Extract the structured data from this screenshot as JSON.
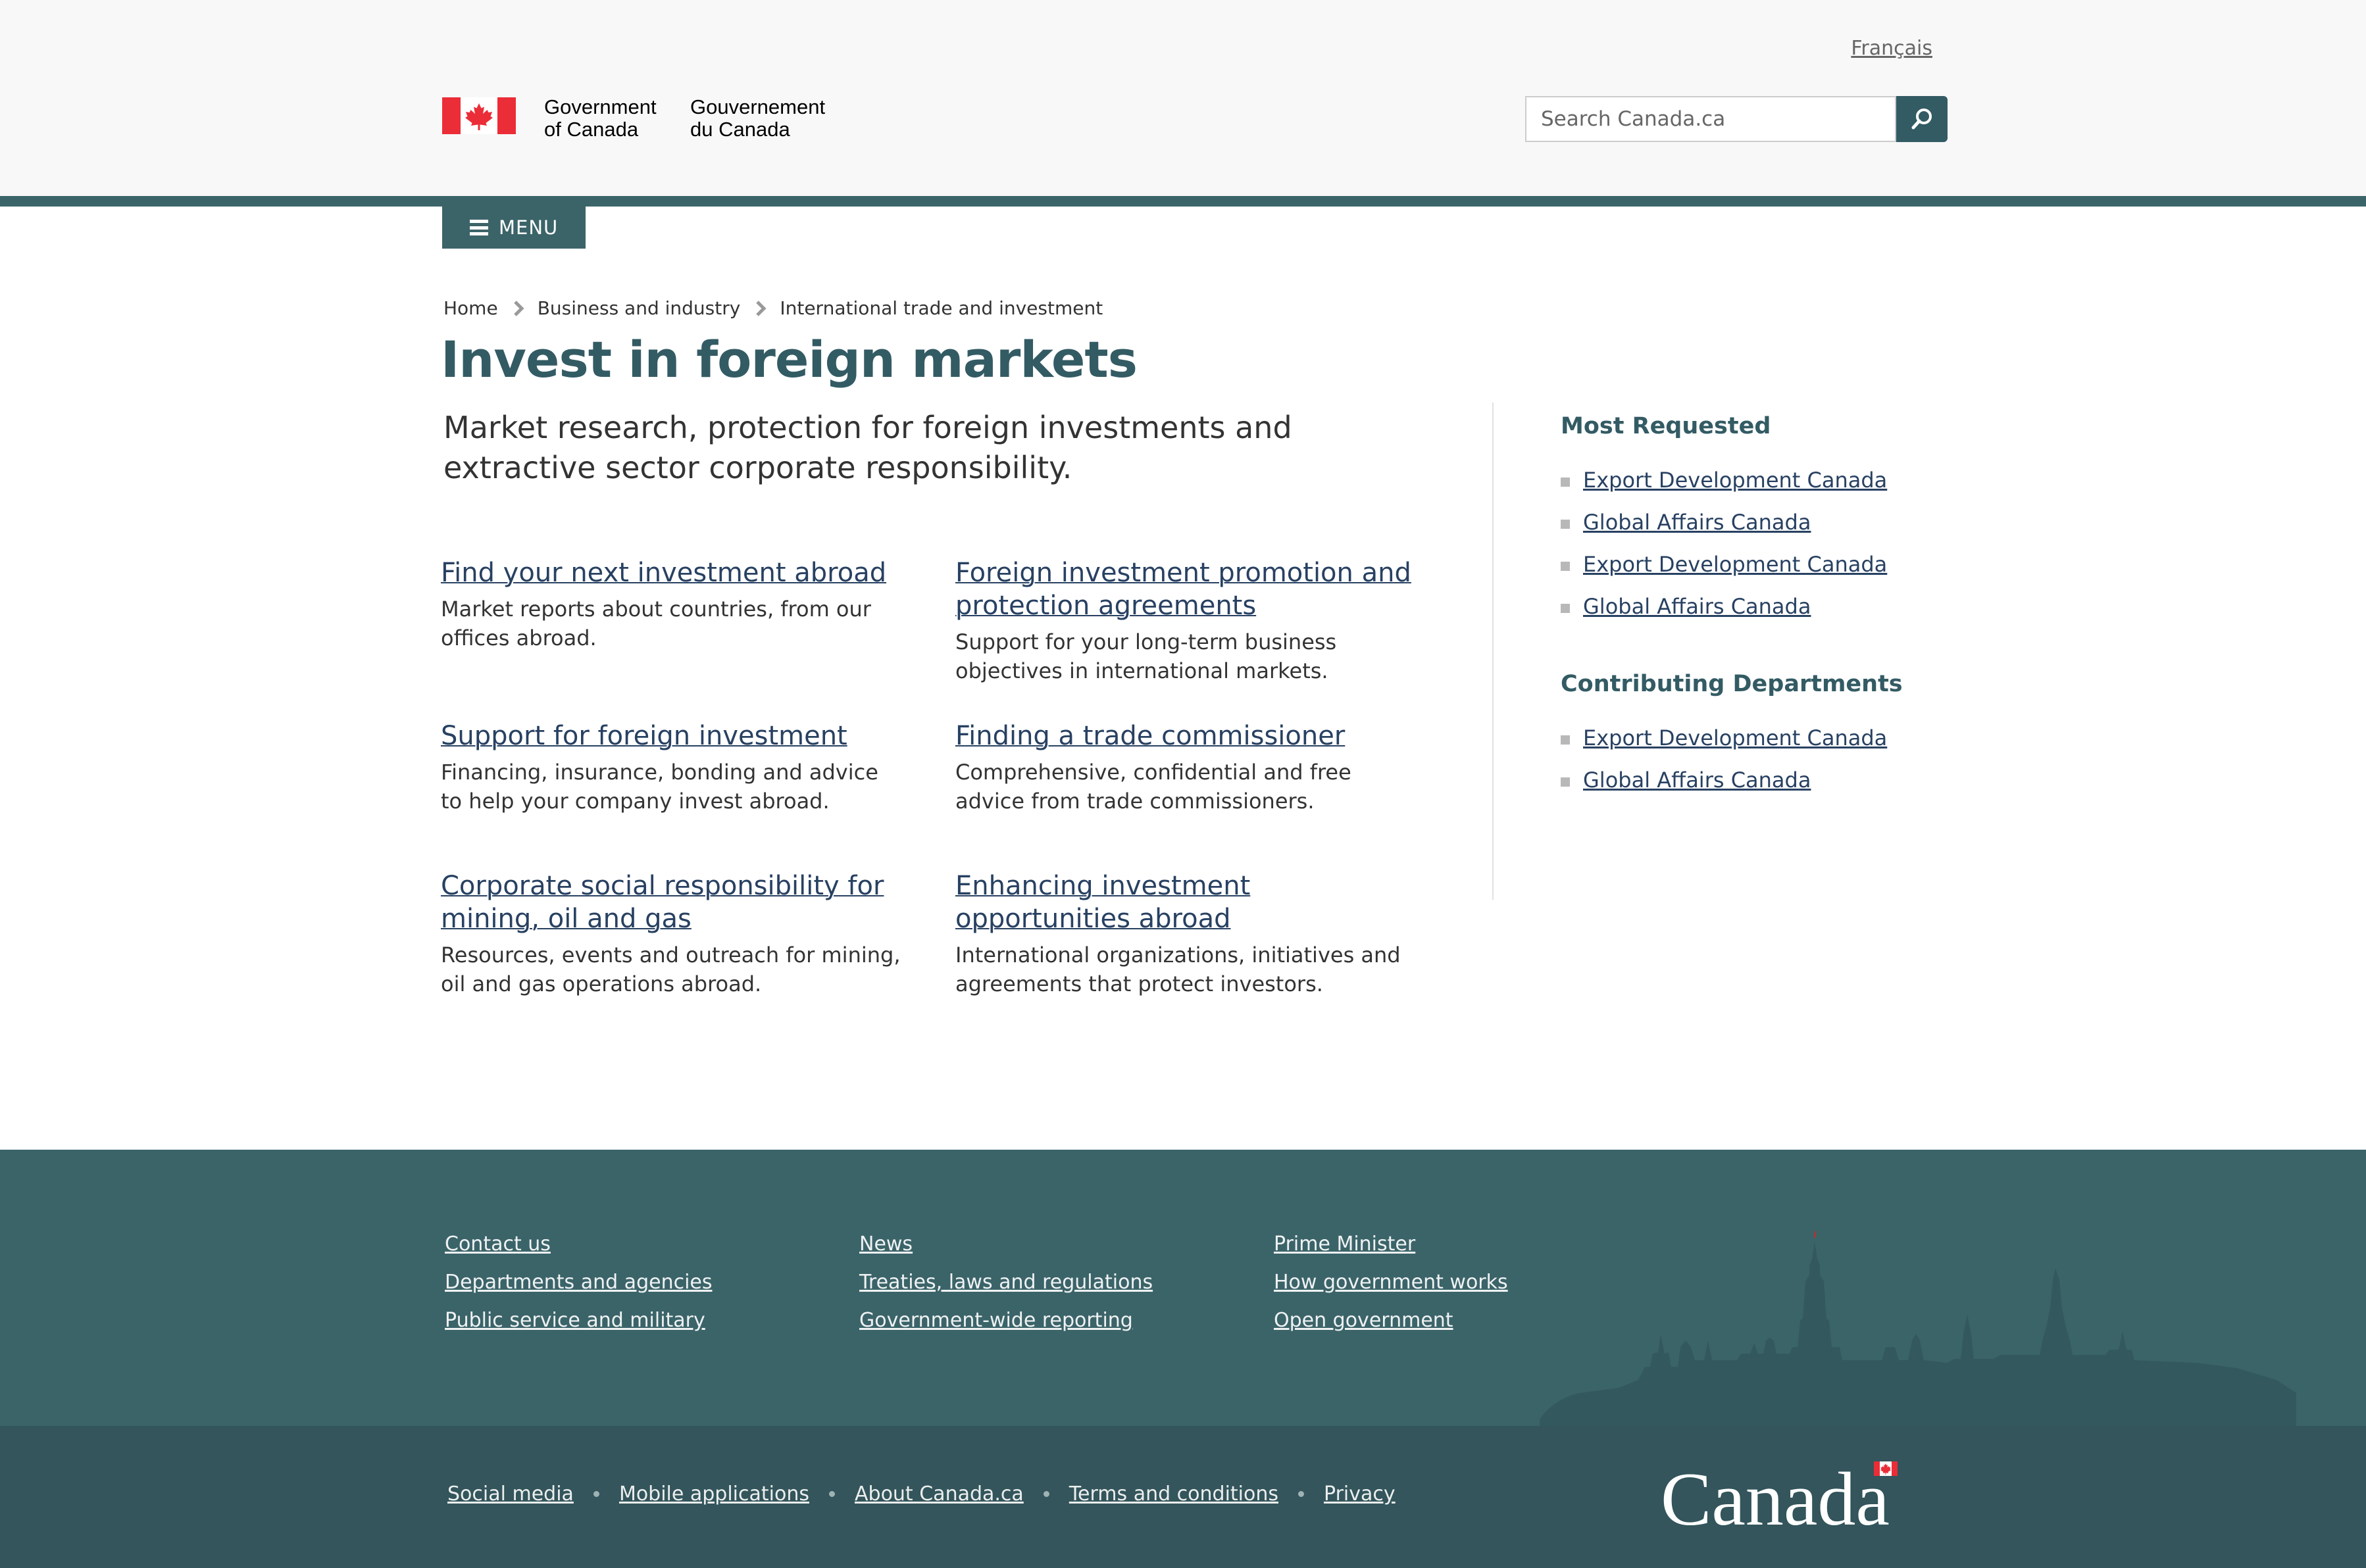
{
  "header": {
    "lang_link": "Français",
    "signature": {
      "en": "Government\nof Canada",
      "fr": "Gouvernement\ndu Canada"
    },
    "search_placeholder": "Search Canada.ca",
    "menu_label": "MENU",
    "colors": {
      "accent": "#3b6469",
      "flag_red": "#eb2d37"
    }
  },
  "breadcrumb": [
    "Home",
    "Business and industry",
    "International trade and investment"
  ],
  "page": {
    "title": "Invest in foreign markets",
    "lead": "Market research, protection for foreign investments and extractive sector corporate responsibility."
  },
  "features": [
    {
      "title": "Find your next investment abroad",
      "desc": "Market reports about countries, from our offices abroad."
    },
    {
      "title": "Foreign investment promotion and protection agreements",
      "desc": "Support for your long-term business objectives in international markets."
    },
    {
      "title": "Support for foreign investment",
      "desc": "Financing, insurance, bonding and advice to help your company invest abroad."
    },
    {
      "title": "Finding a trade commissioner",
      "desc": "Comprehensive, confidential and free advice from trade commissioners."
    },
    {
      "title": "Corporate social responsibility for mining, oil and gas",
      "desc": "Resources, events and outreach for mining, oil and gas operations abroad."
    },
    {
      "title": "Enhancing investment opportunities abroad",
      "desc": "International organizations, initiatives and agreements that protect investors."
    }
  ],
  "sidebar": {
    "most_requested": {
      "heading": "Most Requested",
      "items": [
        "Export Development Canada",
        "Global Affairs Canada",
        "Export Development Canada",
        "Global Affairs Canada"
      ]
    },
    "contributing": {
      "heading": "Contributing Departments",
      "items": [
        "Export Development Canada",
        "Global Affairs Canada"
      ]
    }
  },
  "footer": {
    "col1": [
      "Contact us",
      "Departments and agencies",
      "Public service and military"
    ],
    "col2": [
      "News",
      "Treaties, laws and regulations",
      "Government-wide reporting"
    ],
    "col3": [
      "Prime Minister",
      "How government works",
      "Open government"
    ],
    "bottom_links": [
      "Social media",
      "Mobile applications",
      "About Canada.ca",
      "Terms and conditions",
      "Privacy"
    ],
    "wordmark": "Canada"
  }
}
